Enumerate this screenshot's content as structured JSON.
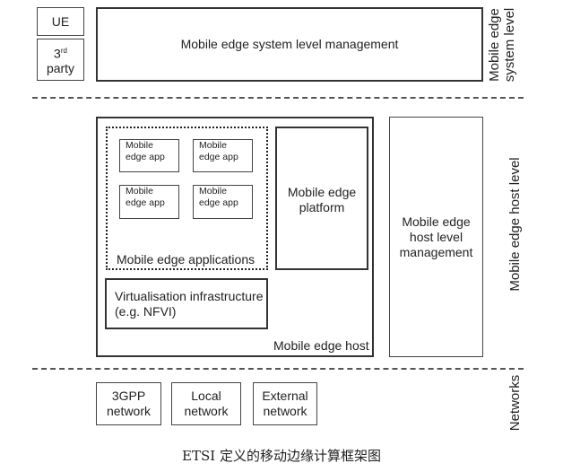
{
  "diagram": {
    "system_level": {
      "ue_label": "UE",
      "third_party_label_main": "3",
      "third_party_label_sup": "rd",
      "third_party_label_line2": "party",
      "system_management_label": "Mobile edge system level management",
      "level_label_line1": "Mobile edge",
      "level_label_line2": "system level"
    },
    "host_level": {
      "apps": [
        {
          "line1": "Mobile",
          "line2": "edge app"
        },
        {
          "line1": "Mobile",
          "line2": "edge app"
        },
        {
          "line1": "Mobile",
          "line2": "edge app"
        },
        {
          "line1": "Mobile",
          "line2": "edge app"
        }
      ],
      "applications_group_label": "Mobile edge applications",
      "platform_line1": "Mobile edge",
      "platform_line2": "platform",
      "virtualisation_line1": "Virtualisation infrastructure",
      "virtualisation_line2": "(e.g. NFVI)",
      "host_label": "Mobile edge host",
      "host_mgmt_line1": "Mobile edge",
      "host_mgmt_line2": "host level",
      "host_mgmt_line3": "management",
      "level_label": "Mobile edge host level"
    },
    "networks": {
      "items": [
        {
          "line1": "3GPP",
          "line2": "network"
        },
        {
          "line1": "Local",
          "line2": "network"
        },
        {
          "line1": "External",
          "line2": "network"
        }
      ],
      "level_label": "Networks"
    },
    "caption": "ETSI 定义的移动边缘计算框架图"
  }
}
